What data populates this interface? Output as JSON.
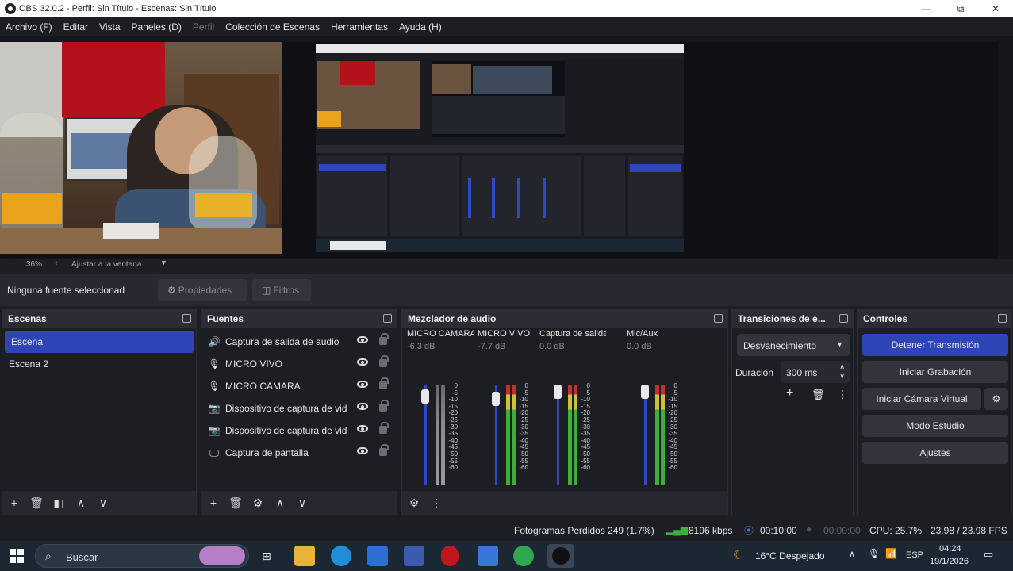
{
  "window": {
    "title": "OBS 32.0.2 - Perfil: Sin Título - Escenas: Sin Título",
    "controls": [
      "—",
      "⧉",
      "✕"
    ]
  },
  "menu": {
    "items": [
      "Archivo (F)",
      "Editar",
      "Vista",
      "Paneles (D)",
      "Perfil",
      "Colección de Escenas",
      "Herramientas",
      "Ayuda (H)"
    ]
  },
  "preview": {
    "zoom": "36%",
    "fit_label": "Ajustar a la ventana"
  },
  "source_toolbar": {
    "selection": "Ninguna fuente seleccionad",
    "properties": "Propiedades",
    "filters": "Filtros"
  },
  "scenes": {
    "title": "Escenas",
    "items": [
      "Escena",
      "Escena 2"
    ],
    "selected": "Escena"
  },
  "sources": {
    "title": "Fuentes",
    "items": [
      {
        "label": "Captura de salida de audio",
        "icon": "speaker-icon"
      },
      {
        "label": "MICRO VIVO",
        "icon": "mic-icon"
      },
      {
        "label": "MICRO CAMARA",
        "icon": "mic-icon"
      },
      {
        "label": "Dispositivo de captura de vid",
        "icon": "camera-icon"
      },
      {
        "label": "Dispositivo de captura de vid",
        "icon": "camera-icon"
      },
      {
        "label": "Captura de pantalla",
        "icon": "monitor-icon"
      }
    ]
  },
  "mixer": {
    "title": "Mezclador de audio",
    "channels": [
      {
        "name": "MICRO CAMARA",
        "db": "-6.3 dB",
        "level": 0.8,
        "muted": true
      },
      {
        "name": "MICRO VIVO",
        "db": "-7.7 dB",
        "level": 0.7,
        "muted": false
      },
      {
        "name": "Captura de salida c",
        "db": "0.0 dB",
        "level": 1.0,
        "muted": false
      },
      {
        "name": "Mic/Aux",
        "db": "0.0 dB",
        "level": 1.0,
        "muted": false
      }
    ],
    "scale": [
      "0",
      "-5",
      "-10",
      "-15",
      "-20",
      "-25",
      "-30",
      "-35",
      "-40",
      "-45",
      "-50",
      "-55",
      "-60"
    ]
  },
  "transitions": {
    "title": "Transiciones de e...",
    "type": "Desvanecimiento",
    "duration_label": "Duración",
    "duration": "300 ms"
  },
  "controls": {
    "title": "Controles",
    "stop_stream": "Detener Transmisión",
    "start_record": "Iniciar Grabación",
    "start_vcam": "Iniciar Cámara Virtual",
    "studio_mode": "Modo Estudio",
    "settings": "Ajustes"
  },
  "status": {
    "dropped": "Fotogramas Perdidos 249 (1.7%)",
    "bitrate": "8196 kbps",
    "stream_time": "00:10:00",
    "rec_time": "00:00:00",
    "cpu": "CPU: 25.7%",
    "fps": "23.98 / 23.98 FPS"
  },
  "taskbar": {
    "search": "Buscar",
    "weather": "16°C  Despejado",
    "lang": "ESP",
    "time": "04:24",
    "date": "19/1/2026"
  },
  "colors": {
    "accent": "#2d45b6",
    "bg": "#1d1e24",
    "panel": "#272831",
    "meter_green": "#3db03a",
    "meter_yellow": "#c9c23a",
    "meter_red": "#c0312b"
  }
}
